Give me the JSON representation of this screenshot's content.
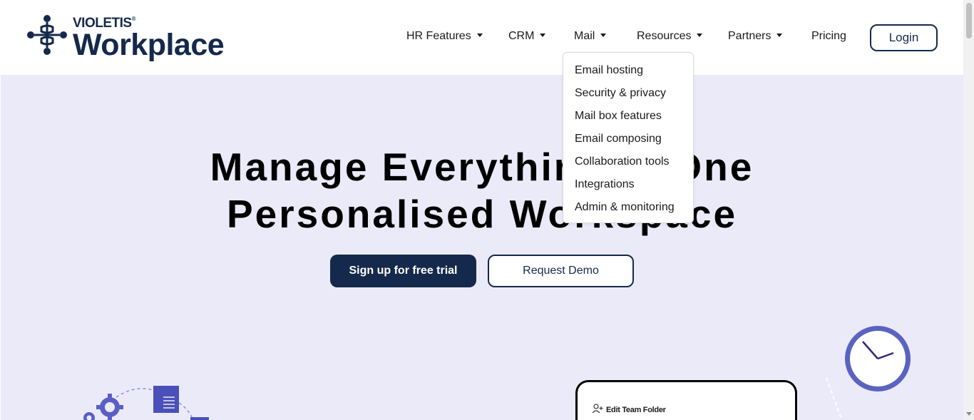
{
  "brand": {
    "name_small": "VIOLETIS",
    "registered_mark": "®",
    "name_big": "Workplace",
    "logo_icon": "violetis-logo-icon",
    "color": "#14294b"
  },
  "nav": {
    "items": [
      {
        "label": "HR Features",
        "has_dropdown": true
      },
      {
        "label": "CRM",
        "has_dropdown": true
      },
      {
        "label": "Mail",
        "has_dropdown": true
      },
      {
        "label": "Resources",
        "has_dropdown": true
      },
      {
        "label": "Partners",
        "has_dropdown": true
      },
      {
        "label": "Pricing",
        "has_dropdown": false
      }
    ],
    "login_label": "Login"
  },
  "mail_dropdown": {
    "items": [
      "Email hosting",
      "Security & privacy",
      "Mail box features",
      "Email composing",
      "Collaboration tools",
      "Integrations",
      "Admin & monitoring"
    ]
  },
  "hero": {
    "title_line1": "Manage Everything in One",
    "title_line2": "Personalised Workspace",
    "primary_cta": "Sign up for free trial",
    "secondary_cta": "Request Demo",
    "background": "#ebeaf9"
  },
  "illustration": {
    "card_label": "Edit Team Folder",
    "card_icon": "add-user-icon",
    "clock_icon": "clock-icon",
    "gears_icon": "gears-icon",
    "document_icon": "document-icon"
  },
  "colors": {
    "primary": "#14294b",
    "accent": "#5a5fc6"
  }
}
